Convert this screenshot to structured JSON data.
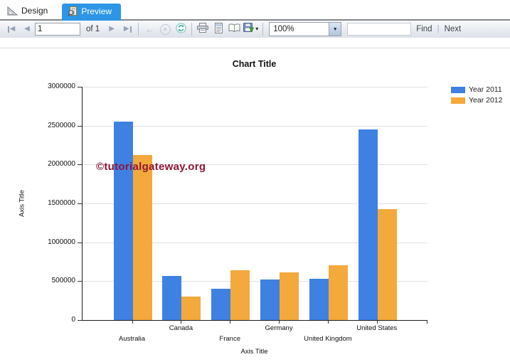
{
  "tabs": {
    "design": "Design",
    "preview": "Preview"
  },
  "toolbar": {
    "page_number": "1",
    "page_count_label": "of 1",
    "zoom_value": "100%",
    "find_label": "Find",
    "find_separator": "|",
    "next_label": "Next"
  },
  "icons": {
    "first_page": "◀",
    "previous_page": "◀",
    "next_page": "▶",
    "last_page": "▶",
    "back": "←",
    "stop": "×",
    "export_caret": "▾",
    "zoom_dropdown": "▼"
  },
  "watermark": "©tutorialgateway.org",
  "colors": {
    "active_tab": "#2d95e5",
    "series_2011": "#3f81e2",
    "series_2012": "#f3a93c",
    "watermark": "#8e1537"
  },
  "chart_data": {
    "type": "bar",
    "title": "Chart Title",
    "x_axis_title": "Axis Title",
    "y_axis_title": "Axis Title",
    "categories": [
      "Australia",
      "Canada",
      "France",
      "Germany",
      "United Kingdom",
      "United States"
    ],
    "series": [
      {
        "name": "Year 2011",
        "color": "#3f81e2",
        "values": [
          2550000,
          570000,
          405000,
          520000,
          535000,
          2450000
        ]
      },
      {
        "name": "Year 2012",
        "color": "#f3a93c",
        "values": [
          2120000,
          300000,
          640000,
          610000,
          700000,
          1430000
        ]
      }
    ],
    "ylim": [
      0,
      3000000
    ],
    "y_ticks": [
      0,
      500000,
      1000000,
      1500000,
      2000000,
      2500000,
      3000000
    ],
    "grid": true,
    "legend_position": "top-right"
  }
}
